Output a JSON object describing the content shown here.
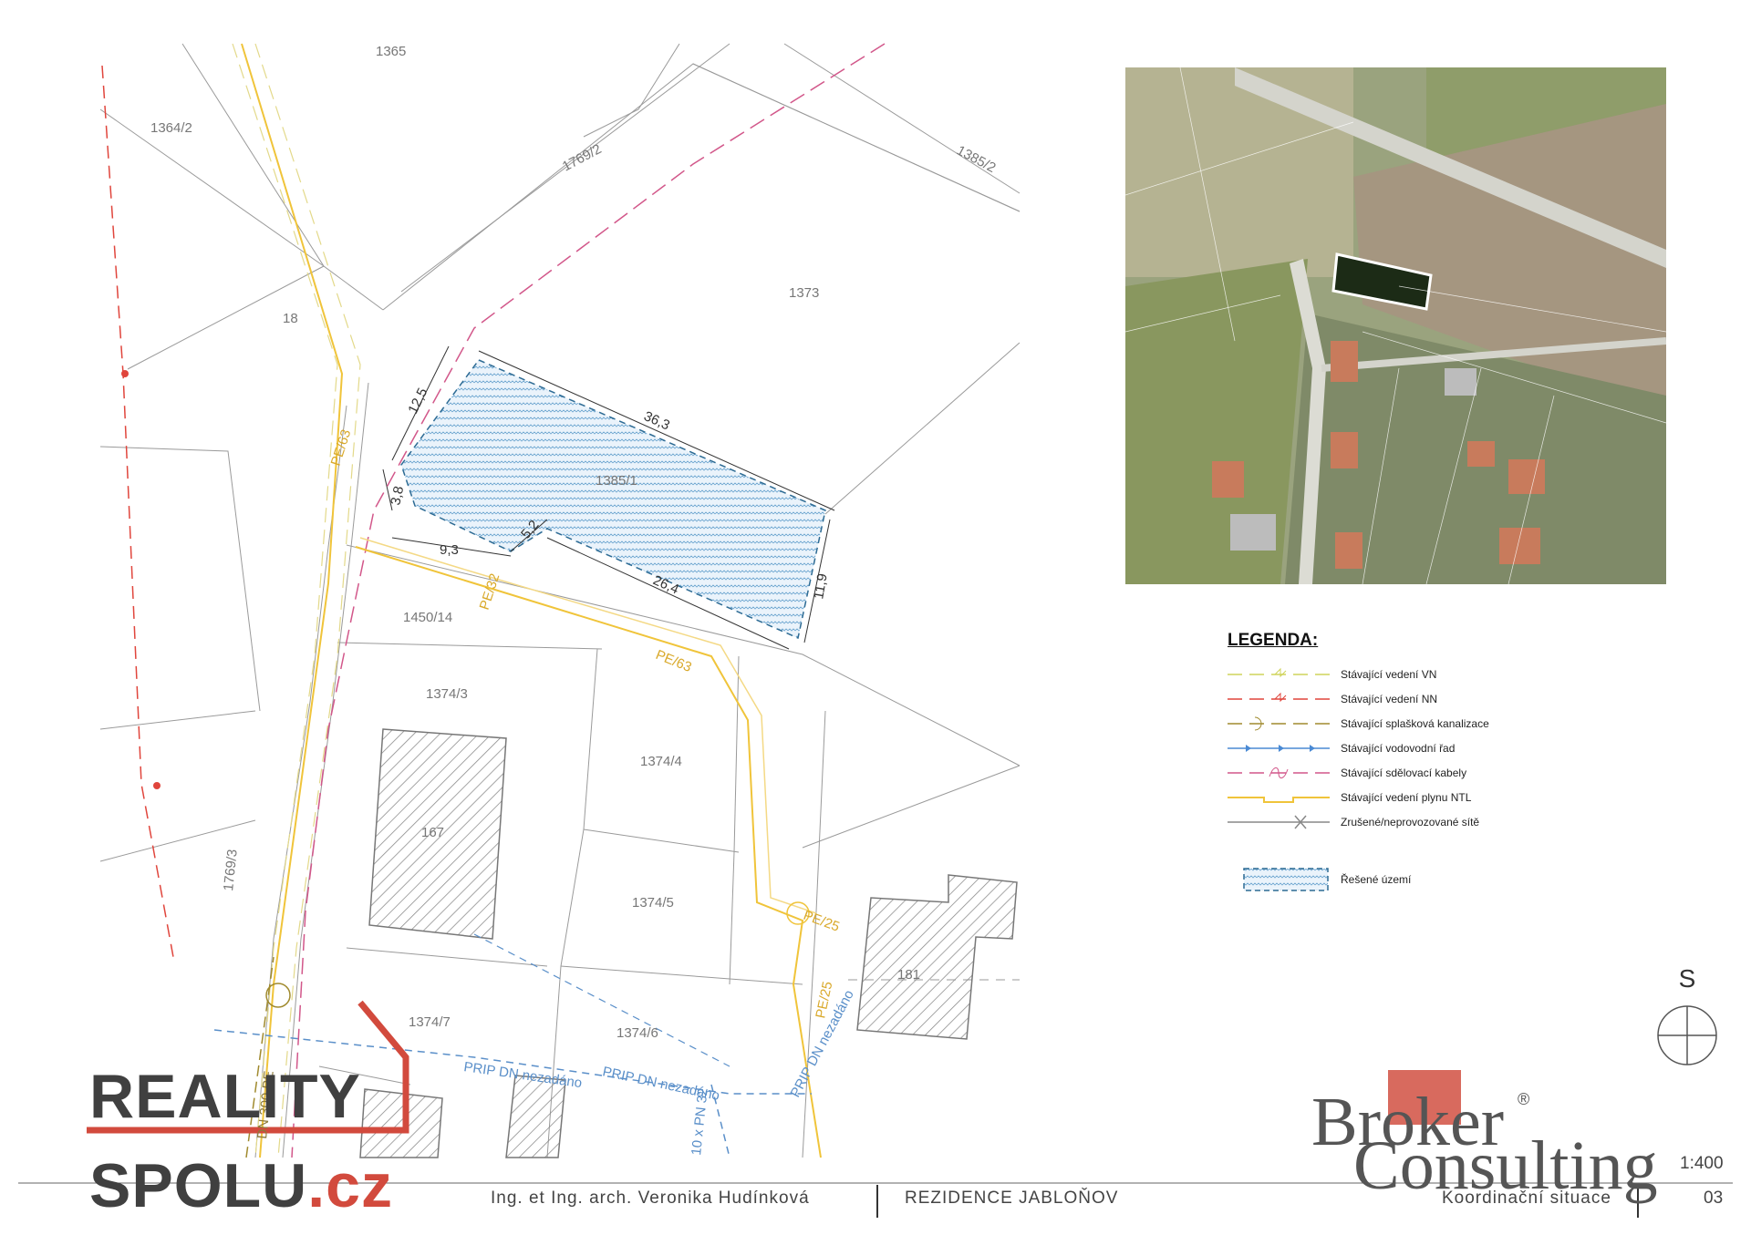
{
  "parcels": [
    "1365",
    "1364/2",
    "1769/2",
    "1385/2",
    "18",
    "1373",
    "1385/1",
    "1450/14",
    "1374/3",
    "1374/4",
    "167",
    "1374/5",
    "1769/3",
    "181",
    "1374/7",
    "1374/6"
  ],
  "utility_labels": {
    "pe63_a": "PE/63",
    "pe63_b": "PE/63",
    "pe32": "PE/32",
    "pe25_a": "PE/25",
    "pe25_b": "PE/25",
    "dn300": "DN 300 BE",
    "prip1": "PRIP DN nezadáno",
    "prip2": "PRIP DN nezadáno",
    "prip3": "PRIP DN nezadáno",
    "pn32": "10 x PN 32"
  },
  "dimensions": [
    "12,5",
    "36,3",
    "3,8",
    "9,3",
    "5,2",
    "26,4",
    "11,9"
  ],
  "legend": {
    "title": "LEGENDA:",
    "items": [
      {
        "label": "Stávající vedení VN",
        "color": "#cfd35a"
      },
      {
        "label": "Stávající vedení NN",
        "color": "#e0453c"
      },
      {
        "label": "Stávající splašková kanalizace",
        "color": "#a08a2e"
      },
      {
        "label": "Stávající vodovodní řad",
        "color": "#4a8ad4"
      },
      {
        "label": "Stávající sdělovací kabely",
        "color": "#d2578a"
      },
      {
        "label": "Stávající vedení plynu NTL",
        "color": "#f0c43a"
      },
      {
        "label": "Zrušené/neprovozované sítě",
        "color": "#888888"
      }
    ],
    "area_label": "Řešené území"
  },
  "north_label": "S",
  "reality_logo": {
    "line1": "REALITY",
    "line2": "SPOLU",
    "line2_suffix": ".cz",
    "accent": "#d24a3d"
  },
  "broker_logo": {
    "line1": "Broker",
    "line2": "Consulting",
    "reg": "®",
    "accent": "#d86a5e"
  },
  "footer": {
    "author": "Ing. et Ing. arch. Veronika Hudínková",
    "project": "REZIDENCE JABLOŇOV",
    "drawing": "Koordinační situace",
    "scale": "1:400",
    "sheet": "03"
  }
}
